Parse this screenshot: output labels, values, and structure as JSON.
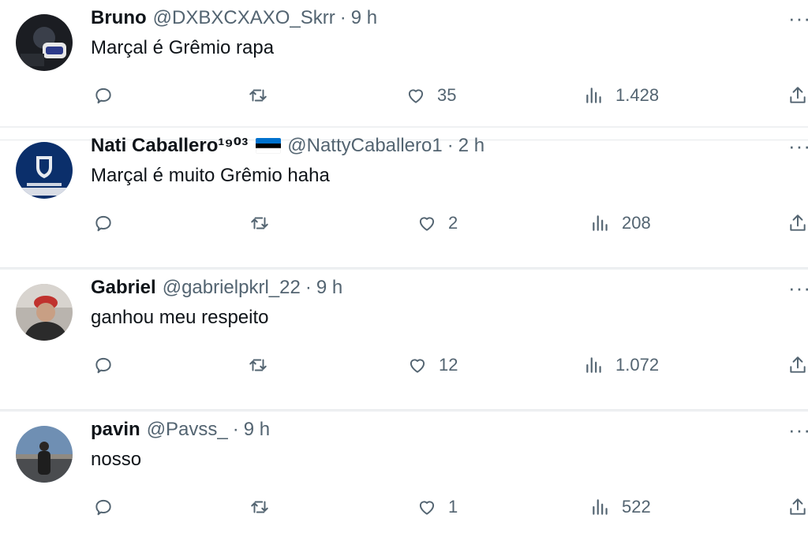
{
  "replies": [
    {
      "name": "Bruno",
      "handle": "@DXBXCXAXO_Skrr",
      "separator": "·",
      "time": "9 h",
      "text": "Marçal é Grêmio rapa",
      "more": "···",
      "likes": "35",
      "views": "1.428"
    },
    {
      "name": "Nati Caballero¹⁹⁰³",
      "handle": "@NattyCaballero1",
      "separator": "·",
      "time": "2 h",
      "text": "Marçal é muito Grêmio haha",
      "more": "···",
      "likes": "2",
      "views": "208",
      "flag": "estonia-flag"
    },
    {
      "name": "Gabriel",
      "handle": "@gabrielpkrl_22",
      "separator": "·",
      "time": "9 h",
      "text": "ganhou meu respeito",
      "more": "···",
      "likes": "12",
      "views": "1.072"
    },
    {
      "name": "pavin",
      "handle": "@Pavss_",
      "separator": "·",
      "time": "9 h",
      "text": "nosso",
      "more": "···",
      "likes": "1",
      "views": "522"
    }
  ],
  "icons": [
    "reply-icon",
    "retweet-icon",
    "like-icon",
    "views-icon",
    "share-icon",
    "more-icon"
  ],
  "colors": {
    "text": "#0f1419",
    "secondary": "#536471",
    "divider": "#eff1f3"
  }
}
